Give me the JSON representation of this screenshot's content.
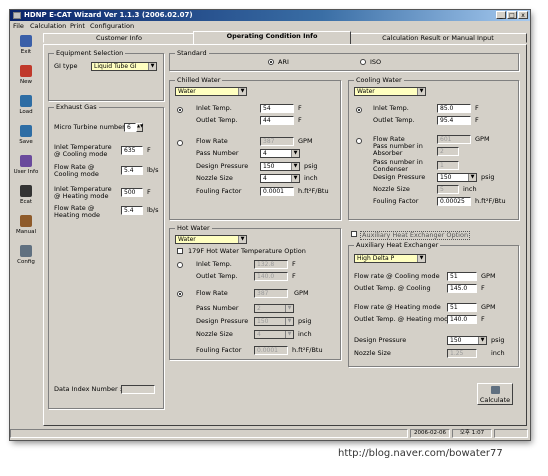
{
  "window": {
    "title": "HDNP E-CAT Wizard  Ver 1.1.3 (2006.02.07)",
    "controls": [
      "_",
      "□",
      "x"
    ]
  },
  "menu": [
    "File",
    "Calculation",
    "Print",
    "Configuration"
  ],
  "toolbar": [
    {
      "label": "Exit",
      "icon": "exit-icon",
      "color": "#3a5fa8"
    },
    {
      "label": "New",
      "icon": "new-icon",
      "color": "#c0392b"
    },
    {
      "label": "Load",
      "icon": "load-icon",
      "color": "#2e6da4"
    },
    {
      "label": "Save",
      "icon": "save-icon",
      "color": "#2e6da4"
    },
    {
      "label": "User Info",
      "icon": "user-info-icon",
      "color": "#6a4a9c"
    },
    {
      "label": "Ecat",
      "icon": "ecat-icon",
      "color": "#333333"
    },
    {
      "label": "Manual",
      "icon": "manual-icon",
      "color": "#8e5a2a"
    },
    {
      "label": "Config",
      "icon": "config-icon",
      "color": "#607080"
    }
  ],
  "tabs": [
    "Customer Info",
    "Operating Condition Info",
    "Calculation Result or Manual Input"
  ],
  "equipment": {
    "title": "Equipment Selection",
    "gi_label": "GI type",
    "gi_value": "Liquid Tube GI"
  },
  "exhaust": {
    "title": "Exhaust Gas",
    "micro_label": "Micro Turbine number",
    "micro_value": "6",
    "inlet_cool_label": "Inlet Temperature @ Cooling mode",
    "inlet_cool_value": "635",
    "inlet_cool_unit": "F",
    "flow_cool_label": "Flow Rate @ Cooling mode",
    "flow_cool_value": "5.4",
    "flow_cool_unit": "lb/s",
    "inlet_heat_label": "Inlet Temperature @ Heating mode",
    "inlet_heat_value": "500",
    "inlet_heat_unit": "F",
    "flow_heat_label": "Flow Rate @ Heating mode",
    "flow_heat_value": "5.4",
    "flow_heat_unit": "lb/s",
    "data_index_label": "Data Index Number :"
  },
  "standard": {
    "title": "Standard",
    "opt1": "ARI",
    "opt2": "ISO"
  },
  "chilled": {
    "title": "Chilled Water",
    "fluid": "Water",
    "inlet_label": "Inlet Temp.",
    "inlet_value": "54",
    "inlet_unit": "F",
    "outlet_label": "Outlet Temp.",
    "outlet_value": "44",
    "outlet_unit": "F",
    "flow_label": "Flow Rate",
    "flow_value": "387",
    "flow_unit": "GPM",
    "pass_label": "Pass Number",
    "pass_value": "4",
    "pressure_label": "Design Pressure",
    "pressure_value": "150",
    "pressure_unit": "psig",
    "nozzle_label": "Nozzle Size",
    "nozzle_value": "4",
    "nozzle_unit": "inch",
    "fouling_label": "Fouling Factor",
    "fouling_value": "0.0001",
    "fouling_unit": "h.ft²F/Btu"
  },
  "cooling": {
    "title": "Cooling Water",
    "fluid": "Water",
    "inlet_label": "Inlet Temp.",
    "inlet_value": "85.0",
    "inlet_unit": "F",
    "outlet_label": "Outlet Temp.",
    "outlet_value": "95.4",
    "outlet_unit": "F",
    "flow_label": "Flow Rate",
    "flow_value": "601",
    "flow_unit": "GPM",
    "pass_abs_label": "Pass number in Absorber",
    "pass_abs_value": "2",
    "pass_con_label": "Pass number in Condenser",
    "pass_con_value": "1",
    "pressure_label": "Design Pressure",
    "pressure_value": "150",
    "pressure_unit": "psig",
    "nozzle_label": "Nozzle Size",
    "nozzle_value": "5",
    "nozzle_unit": "inch",
    "fouling_label": "Fouling Factor",
    "fouling_value": "0.00025",
    "fouling_unit": "h.ft²F/Btu"
  },
  "hot": {
    "title": "Hot Water",
    "fluid": "Water",
    "option_label": "179F Hot Water Temperature Option",
    "inlet_label": "Inlet Temp.",
    "inlet_value": "132.8",
    "inlet_unit": "F",
    "outlet_label": "Outlet Temp.",
    "outlet_value": "140.0",
    "outlet_unit": "F",
    "flow_label": "Flow Rate",
    "flow_value": "387",
    "flow_unit": "GPM",
    "pass_label": "Pass Number",
    "pass_value": "2",
    "pressure_label": "Design Pressure",
    "pressure_value": "150",
    "pressure_unit": "psig",
    "nozzle_label": "Nozzle Size",
    "nozzle_value": "4",
    "nozzle_unit": "inch",
    "fouling_label": "Fouling Factor",
    "fouling_value": "0.0001",
    "fouling_unit": "h.ft²F/Btu"
  },
  "aux": {
    "title": "Auxiliary Heat Exchanger",
    "option_label": "Auxiliary Heat Exchanger Option",
    "mode": "High Delta P",
    "flow_cool_label": "Flow rate @ Cooling mode",
    "flow_cool_value": "51",
    "flow_cool_unit": "GPM",
    "outlet_cool_label": "Outlet Temp. @ Cooling",
    "outlet_cool_value": "145.0",
    "outlet_cool_unit": "F",
    "flow_heat_label": "Flow rate @ Heating mode",
    "flow_heat_value": "51",
    "flow_heat_unit": "GPM",
    "outlet_heat_label": "Outlet Temp. @ Heating mode",
    "outlet_heat_value": "140.0",
    "outlet_heat_unit": "F",
    "pressure_label": "Design Pressure",
    "pressure_value": "150",
    "pressure_unit": "psig",
    "nozzle_label": "Nozzle Size",
    "nozzle_value": "1.25",
    "nozzle_unit": "inch"
  },
  "calculate_label": "Calculate",
  "status": {
    "date": "2006-02-06",
    "time": "오후 1:07"
  },
  "watermark": "http://blog.naver.com/bowater77"
}
